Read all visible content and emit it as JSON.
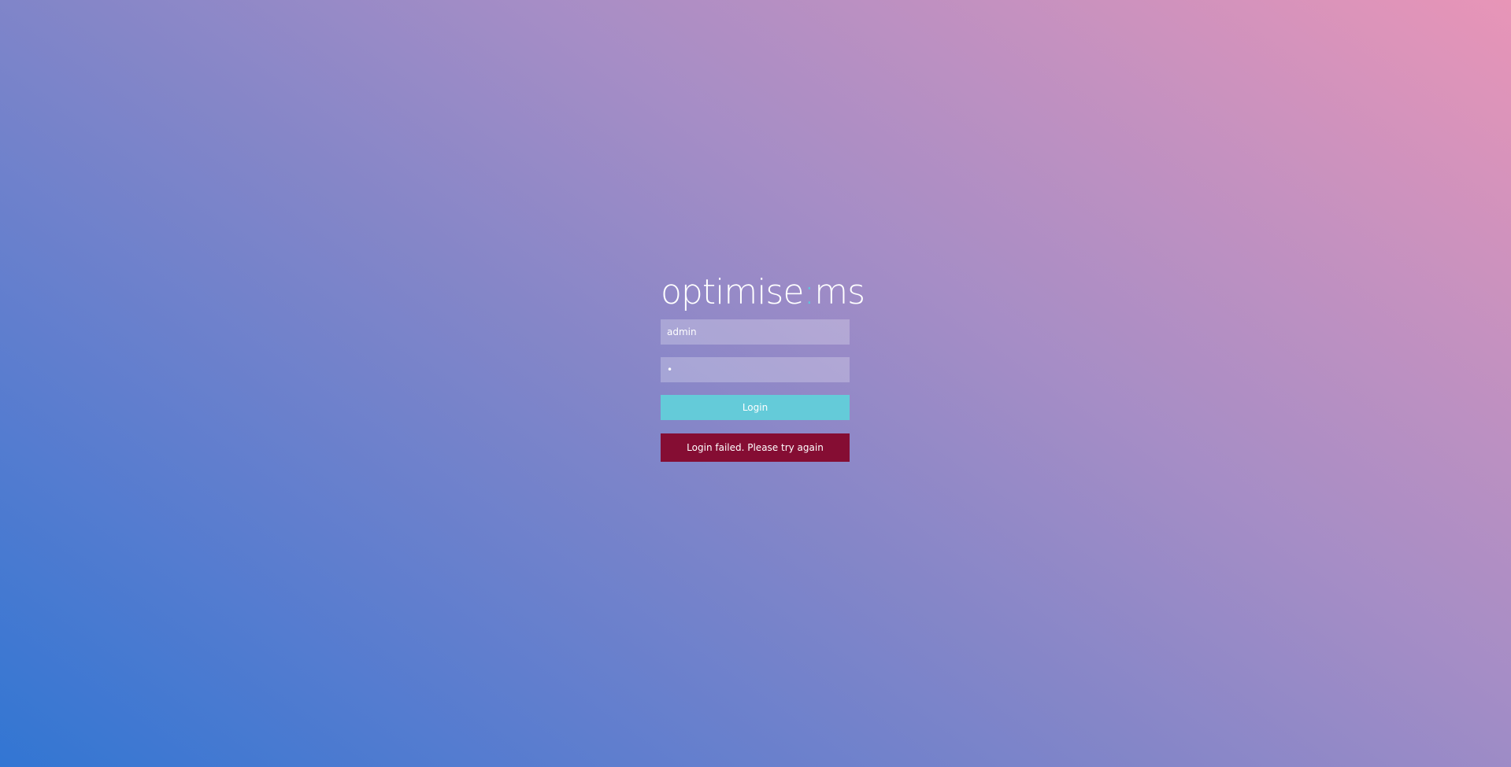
{
  "brand": {
    "logo_part1": "optimise",
    "logo_separator": ":",
    "logo_part2": "ms"
  },
  "form": {
    "username_value": "admin",
    "password_value": "•",
    "login_label": "Login"
  },
  "error": {
    "message": "Login failed. Please try again"
  },
  "colors": {
    "accent": "#64cbd9",
    "error_bg": "#850d33",
    "gradient_start": "#3276d3",
    "gradient_end": "#e895b7"
  }
}
